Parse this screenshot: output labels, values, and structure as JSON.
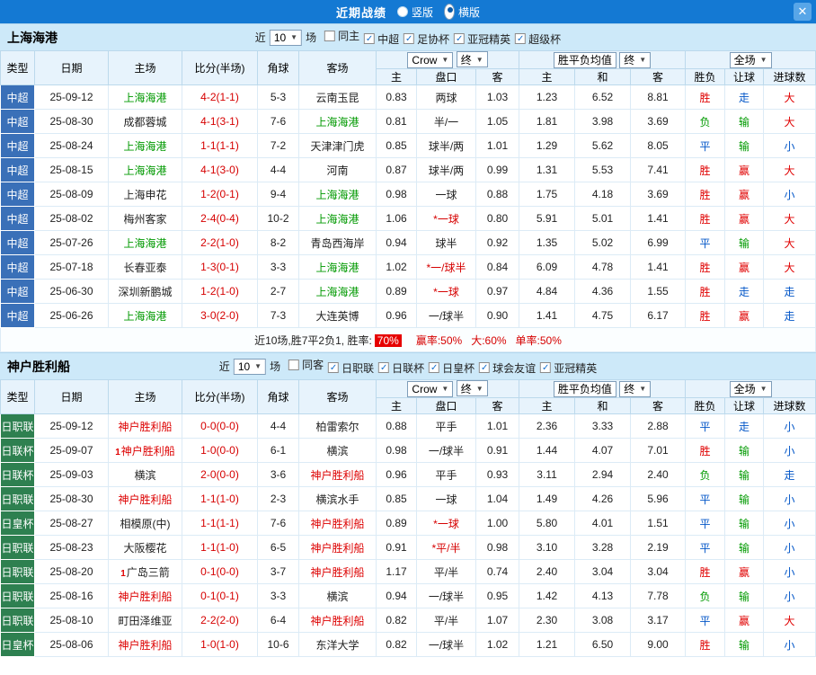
{
  "topbar": {
    "title": "近期战绩",
    "radio_vertical": "竖版",
    "radio_horizontal": "横版",
    "selected": "横版",
    "close_icon": "✕"
  },
  "icons": {
    "dropdown": "▼",
    "check": "✓",
    "close": "✕"
  },
  "labels": {
    "near": "近",
    "matches": "场"
  },
  "colors": {
    "topbar_bg": "#1479d3",
    "section_header_bg": "#cde9f9",
    "win_red": "#e00000",
    "lose_green": "#009a00",
    "push_blue": "#0457c8"
  },
  "table_headers": {
    "type": "类型",
    "date": "日期",
    "home": "主场",
    "score": "比分(半场)",
    "corner": "角球",
    "away": "客场",
    "h_home": "主",
    "h_line": "盘口",
    "h_away": "客",
    "a_home": "主",
    "a_draw": "和",
    "a_away": "客",
    "r_wdl": "胜负",
    "r_let": "让球",
    "r_goals": "进球数",
    "company": "Crow",
    "final": "终",
    "avg": "胜平负均值",
    "scope": "全场"
  },
  "sections": [
    {
      "team": "上海海港",
      "count": "10",
      "badge_color": "#3a70b8",
      "featured_color": "#009900",
      "filters": [
        {
          "label": "同主",
          "checked": false
        },
        {
          "label": "中超",
          "checked": true
        },
        {
          "label": "足协杯",
          "checked": true
        },
        {
          "label": "亚冠精英",
          "checked": true
        },
        {
          "label": "超级杯",
          "checked": true
        }
      ],
      "rows": [
        {
          "t": "中超",
          "d": "25-09-12",
          "h": "上海海港",
          "hf": true,
          "s": "4-2(1-1)",
          "c": "5-3",
          "a": "云南玉昆",
          "af": false,
          "o": [
            "0.83",
            "两球",
            "1.03"
          ],
          "v": [
            "1.23",
            "6.52",
            "8.81"
          ],
          "r": [
            "胜",
            "走",
            "大"
          ]
        },
        {
          "t": "中超",
          "d": "25-08-30",
          "h": "成都蓉城",
          "hf": false,
          "s": "4-1(3-1)",
          "c": "7-6",
          "a": "上海海港",
          "af": true,
          "o": [
            "0.81",
            "半/一",
            "1.05"
          ],
          "v": [
            "1.81",
            "3.98",
            "3.69"
          ],
          "r": [
            "负",
            "输",
            "大"
          ]
        },
        {
          "t": "中超",
          "d": "25-08-24",
          "h": "上海海港",
          "hf": true,
          "s": "1-1(1-1)",
          "c": "7-2",
          "a": "天津津门虎",
          "af": false,
          "o": [
            "0.85",
            "球半/两",
            "1.01"
          ],
          "v": [
            "1.29",
            "5.62",
            "8.05"
          ],
          "r": [
            "平",
            "输",
            "小"
          ]
        },
        {
          "t": "中超",
          "d": "25-08-15",
          "h": "上海海港",
          "hf": true,
          "s": "4-1(3-0)",
          "c": "4-4",
          "a": "河南",
          "af": false,
          "o": [
            "0.87",
            "球半/两",
            "0.99"
          ],
          "v": [
            "1.31",
            "5.53",
            "7.41"
          ],
          "r": [
            "胜",
            "赢",
            "大"
          ]
        },
        {
          "t": "中超",
          "d": "25-08-09",
          "h": "上海申花",
          "hf": false,
          "s": "1-2(0-1)",
          "c": "9-4",
          "a": "上海海港",
          "af": true,
          "o": [
            "0.98",
            "一球",
            "0.88"
          ],
          "v": [
            "1.75",
            "4.18",
            "3.69"
          ],
          "r": [
            "胜",
            "赢",
            "小"
          ]
        },
        {
          "t": "中超",
          "d": "25-08-02",
          "h": "梅州客家",
          "hf": false,
          "s": "2-4(0-4)",
          "c": "10-2",
          "a": "上海海港",
          "af": true,
          "o": [
            "1.06",
            "*一球",
            "0.80"
          ],
          "v": [
            "5.91",
            "5.01",
            "1.41"
          ],
          "r": [
            "胜",
            "赢",
            "大"
          ]
        },
        {
          "t": "中超",
          "d": "25-07-26",
          "h": "上海海港",
          "hf": true,
          "s": "2-2(1-0)",
          "c": "8-2",
          "a": "青岛西海岸",
          "af": false,
          "o": [
            "0.94",
            "球半",
            "0.92"
          ],
          "v": [
            "1.35",
            "5.02",
            "6.99"
          ],
          "r": [
            "平",
            "输",
            "大"
          ]
        },
        {
          "t": "中超",
          "d": "25-07-18",
          "h": "长春亚泰",
          "hf": false,
          "s": "1-3(0-1)",
          "c": "3-3",
          "a": "上海海港",
          "af": true,
          "o": [
            "1.02",
            "*一/球半",
            "0.84"
          ],
          "v": [
            "6.09",
            "4.78",
            "1.41"
          ],
          "r": [
            "胜",
            "赢",
            "大"
          ]
        },
        {
          "t": "中超",
          "d": "25-06-30",
          "h": "深圳新鹏城",
          "hf": false,
          "s": "1-2(1-0)",
          "c": "2-7",
          "a": "上海海港",
          "af": true,
          "o": [
            "0.89",
            "*一球",
            "0.97"
          ],
          "v": [
            "4.84",
            "4.36",
            "1.55"
          ],
          "r": [
            "胜",
            "走",
            "走"
          ]
        },
        {
          "t": "中超",
          "d": "25-06-26",
          "h": "上海海港",
          "hf": true,
          "s": "3-0(2-0)",
          "c": "7-3",
          "a": "大连英博",
          "af": false,
          "o": [
            "0.96",
            "一/球半",
            "0.90"
          ],
          "v": [
            "1.41",
            "4.75",
            "6.17"
          ],
          "r": [
            "胜",
            "赢",
            "走"
          ]
        }
      ],
      "summary": {
        "pre": "近10场,胜7平2负1, 胜率:",
        "rate": "70%",
        "stats": [
          "赢率:50%",
          "大:60%",
          "单率:50%"
        ]
      }
    },
    {
      "team": "神户胜利船",
      "count": "10",
      "badge_color": "#2e8050",
      "featured_color": "#dd0000",
      "filters": [
        {
          "label": "同客",
          "checked": false
        },
        {
          "label": "日职联",
          "checked": true
        },
        {
          "label": "日联杯",
          "checked": true
        },
        {
          "label": "日皇杯",
          "checked": true
        },
        {
          "label": "球会友谊",
          "checked": true
        },
        {
          "label": "亚冠精英",
          "checked": true
        }
      ],
      "rows": [
        {
          "t": "日职联",
          "d": "25-09-12",
          "h": "神户胜利船",
          "hf": true,
          "s": "0-0(0-0)",
          "c": "4-4",
          "a": "柏雷索尔",
          "af": false,
          "o": [
            "0.88",
            "平手",
            "1.01"
          ],
          "v": [
            "2.36",
            "3.33",
            "2.88"
          ],
          "r": [
            "平",
            "走",
            "小"
          ]
        },
        {
          "t": "日联杯",
          "d": "25-09-07",
          "h": "神户胜利船",
          "hf": true,
          "hb": "1",
          "s": "1-0(0-0)",
          "c": "6-1",
          "a": "横滨",
          "af": false,
          "o": [
            "0.98",
            "一/球半",
            "0.91"
          ],
          "v": [
            "1.44",
            "4.07",
            "7.01"
          ],
          "r": [
            "胜",
            "输",
            "小"
          ]
        },
        {
          "t": "日联杯",
          "d": "25-09-03",
          "h": "横滨",
          "hf": false,
          "s": "2-0(0-0)",
          "c": "3-6",
          "a": "神户胜利船",
          "af": true,
          "o": [
            "0.96",
            "平手",
            "0.93"
          ],
          "v": [
            "3.11",
            "2.94",
            "2.40"
          ],
          "r": [
            "负",
            "输",
            "走"
          ]
        },
        {
          "t": "日职联",
          "d": "25-08-30",
          "h": "神户胜利船",
          "hf": true,
          "s": "1-1(1-0)",
          "c": "2-3",
          "a": "横滨水手",
          "af": false,
          "o": [
            "0.85",
            "一球",
            "1.04"
          ],
          "v": [
            "1.49",
            "4.26",
            "5.96"
          ],
          "r": [
            "平",
            "输",
            "小"
          ]
        },
        {
          "t": "日皇杯",
          "d": "25-08-27",
          "h": "相模原(中)",
          "hf": false,
          "s": "1-1(1-1)",
          "c": "7-6",
          "a": "神户胜利船",
          "af": true,
          "o": [
            "0.89",
            "*一球",
            "1.00"
          ],
          "v": [
            "5.80",
            "4.01",
            "1.51"
          ],
          "r": [
            "平",
            "输",
            "小"
          ]
        },
        {
          "t": "日职联",
          "d": "25-08-23",
          "h": "大阪樱花",
          "hf": false,
          "s": "1-1(1-0)",
          "c": "6-5",
          "a": "神户胜利船",
          "af": true,
          "o": [
            "0.91",
            "*平/半",
            "0.98"
          ],
          "v": [
            "3.10",
            "3.28",
            "2.19"
          ],
          "r": [
            "平",
            "输",
            "小"
          ]
        },
        {
          "t": "日职联",
          "d": "25-08-20",
          "h": "广岛三箭",
          "hf": false,
          "hb": "1",
          "s": "0-1(0-0)",
          "c": "3-7",
          "a": "神户胜利船",
          "af": true,
          "o": [
            "1.17",
            "平/半",
            "0.74"
          ],
          "v": [
            "2.40",
            "3.04",
            "3.04"
          ],
          "r": [
            "胜",
            "赢",
            "小"
          ]
        },
        {
          "t": "日职联",
          "d": "25-08-16",
          "h": "神户胜利船",
          "hf": true,
          "s": "0-1(0-1)",
          "c": "3-3",
          "a": "横滨",
          "af": false,
          "o": [
            "0.94",
            "一/球半",
            "0.95"
          ],
          "v": [
            "1.42",
            "4.13",
            "7.78"
          ],
          "r": [
            "负",
            "输",
            "小"
          ]
        },
        {
          "t": "日职联",
          "d": "25-08-10",
          "h": "町田泽维亚",
          "hf": false,
          "s": "2-2(2-0)",
          "c": "6-4",
          "a": "神户胜利船",
          "af": true,
          "o": [
            "0.82",
            "平/半",
            "1.07"
          ],
          "v": [
            "2.30",
            "3.08",
            "3.17"
          ],
          "r": [
            "平",
            "赢",
            "大"
          ]
        },
        {
          "t": "日皇杯",
          "d": "25-08-06",
          "h": "神户胜利船",
          "hf": true,
          "s": "1-0(1-0)",
          "c": "10-6",
          "a": "东洋大学",
          "af": false,
          "o": [
            "0.82",
            "一/球半",
            "1.02"
          ],
          "v": [
            "1.21",
            "6.50",
            "9.00"
          ],
          "r": [
            "胜",
            "输",
            "小"
          ]
        }
      ]
    }
  ]
}
